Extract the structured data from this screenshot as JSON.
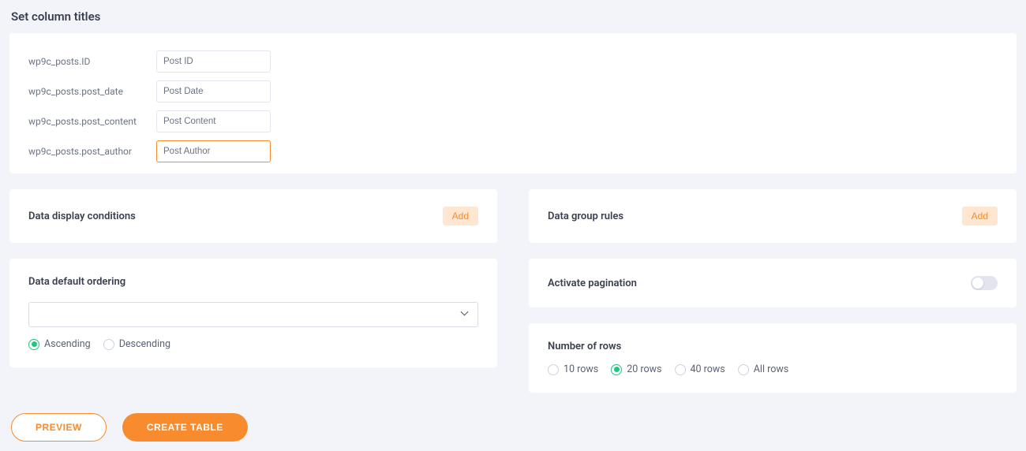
{
  "section_title": "Set column titles",
  "columns": [
    {
      "label": "wp9c_posts.ID",
      "value": "Post ID",
      "active": false
    },
    {
      "label": "wp9c_posts.post_date",
      "value": "Post Date",
      "active": false
    },
    {
      "label": "wp9c_posts.post_content",
      "value": "Post Content",
      "active": false
    },
    {
      "label": "wp9c_posts.post_author",
      "value": "Post Author",
      "active": true
    }
  ],
  "conditions": {
    "title": "Data display conditions",
    "add": "Add"
  },
  "group_rules": {
    "title": "Data group rules",
    "add": "Add"
  },
  "ordering": {
    "title": "Data default ordering",
    "options": [
      {
        "label": "Ascending",
        "checked": true
      },
      {
        "label": "Descending",
        "checked": false
      }
    ]
  },
  "pagination": {
    "title": "Activate pagination",
    "on": false
  },
  "rows": {
    "title": "Number of rows",
    "options": [
      {
        "label": "10 rows",
        "checked": false
      },
      {
        "label": "20 rows",
        "checked": true
      },
      {
        "label": "40 rows",
        "checked": false
      },
      {
        "label": "All rows",
        "checked": false
      }
    ]
  },
  "buttons": {
    "preview": "PREVIEW",
    "create": "CREATE TABLE"
  }
}
